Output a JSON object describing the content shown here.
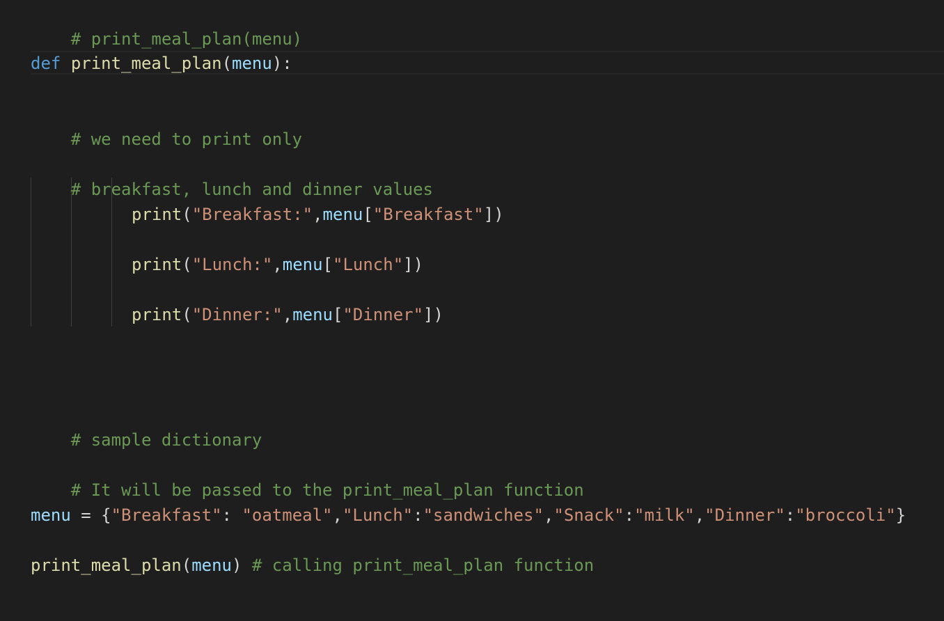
{
  "editor": {
    "theme_colors": {
      "background": "#1e1e1e",
      "comment": "#6a9955",
      "keyword": "#569cd6",
      "function": "#dcdcaa",
      "variable": "#9cdcfe",
      "string": "#ce9178",
      "text": "#d4d4d4"
    },
    "lines": {
      "l1": {
        "comment": "# print_meal_plan(menu)"
      },
      "l2": {
        "kw": "def",
        "fn": "print_meal_plan",
        "open": "(",
        "param": "menu",
        "close": "):"
      },
      "l3": {
        "comment": "# we need to print only"
      },
      "l4": {
        "comment": "# breakfast, lunch and dinner values"
      },
      "l5": {
        "fn": "print",
        "open": "(",
        "s1": "\"Breakfast:\"",
        "comma": ",",
        "var": "menu",
        "lb": "[",
        "s2": "\"Breakfast\"",
        "close": "])"
      },
      "l6": {
        "fn": "print",
        "open": "(",
        "s1": "\"Lunch:\"",
        "comma": ",",
        "var": "menu",
        "lb": "[",
        "s2": "\"Lunch\"",
        "close": "])"
      },
      "l7": {
        "fn": "print",
        "open": "(",
        "s1": "\"Dinner:\"",
        "comma": ",",
        "var": "menu",
        "lb": "[",
        "s2": "\"Dinner\"",
        "close": "])"
      },
      "l8": {
        "comment": "# sample dictionary"
      },
      "l9": {
        "comment": "# It will be passed to the print_meal_plan function"
      },
      "l10": {
        "var": "menu",
        "eq": " = {",
        "k1": "\"Breakfast\"",
        "sep1": ": ",
        "v1": "\"oatmeal\"",
        "c1": ",",
        "k2": "\"Lunch\"",
        "sep2": ":",
        "v2": "\"sandwiches\"",
        "c2": ",",
        "k3": "\"Snack\"",
        "sep3": ":",
        "v3": "\"milk\"",
        "c3": ",",
        "k4": "\"Dinner\"",
        "sep4": ":",
        "v4": "\"broccoli\"",
        "end": "}"
      },
      "l11": {
        "fn": "print_meal_plan",
        "open": "(",
        "arg": "menu",
        "close": ")",
        "space": " ",
        "comment": "# calling print_meal_plan function"
      }
    }
  }
}
